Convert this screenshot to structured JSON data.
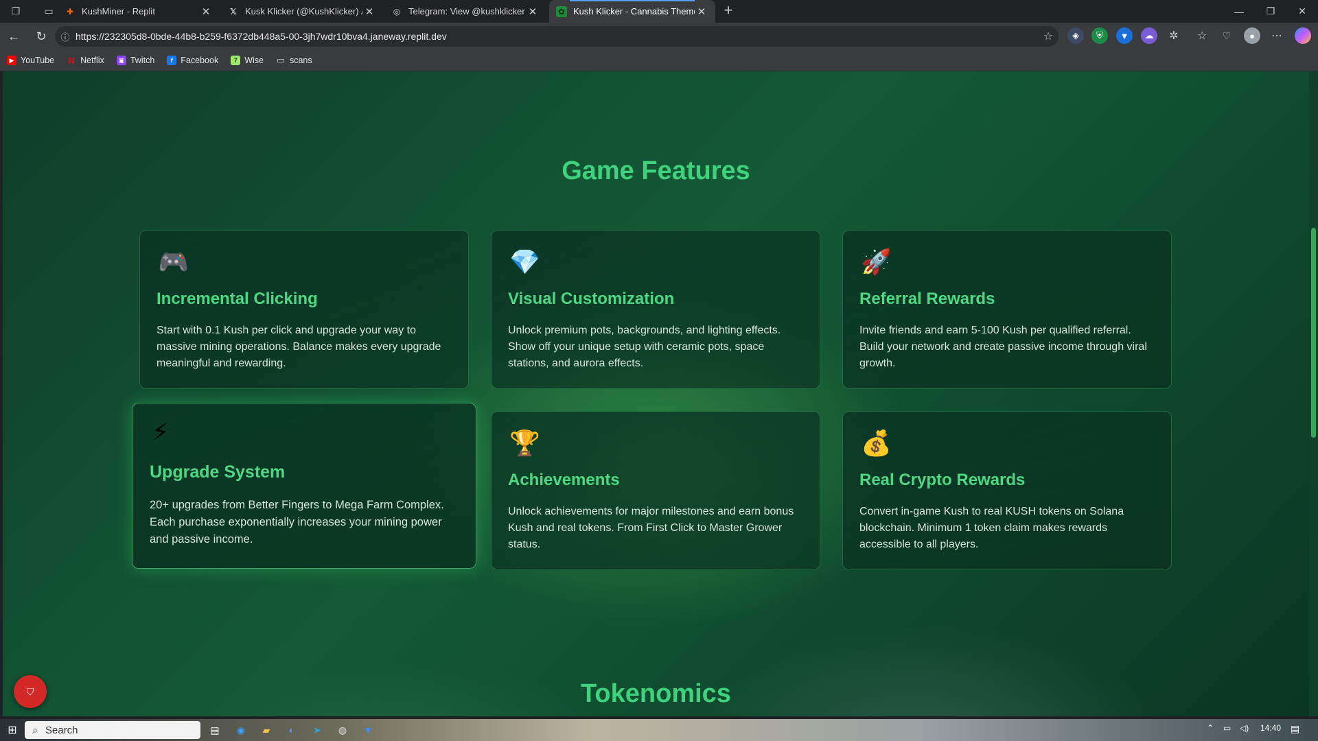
{
  "browser": {
    "tabs": [
      {
        "title": "KushMiner - Replit",
        "favicon": "replit-icon",
        "favcolor": "#f26207"
      },
      {
        "title": "Kusk Klicker (@KushKlicker) / X",
        "favicon": "x-icon",
        "favcolor": "#000000"
      },
      {
        "title": "Telegram: View @kushklicker",
        "favicon": "globe-icon",
        "favcolor": "#444444"
      },
      {
        "title": "Kush Klicker - Cannabis Themed C",
        "favicon": "leaf-icon",
        "favcolor": "#1f8a3b"
      }
    ],
    "url": "https://232305d8-0bde-44b8-b259-f6372db448a5-00-3jh7wdr10bva4.janeway.replit.dev",
    "bookmarks": [
      {
        "label": "YouTube",
        "icon": "youtube-icon",
        "color": "#ff0000"
      },
      {
        "label": "Netflix",
        "icon": "netflix-icon",
        "color": "#e50914"
      },
      {
        "label": "Twitch",
        "icon": "twitch-icon",
        "color": "#9146ff"
      },
      {
        "label": "Facebook",
        "icon": "facebook-icon",
        "color": "#1877f2"
      },
      {
        "label": "Wise",
        "icon": "wise-icon",
        "color": "#9fe870"
      },
      {
        "label": "scans",
        "icon": "folder-icon",
        "color": "#cccccc"
      }
    ]
  },
  "page": {
    "features_title": "Game Features",
    "features": [
      {
        "icon": "🎮",
        "icon_name": "gamepad-icon",
        "title": "Incremental Clicking",
        "desc": "Start with 0.1 Kush per click and upgrade your way to massive mining operations. Balance makes every upgrade meaningful and rewarding."
      },
      {
        "icon": "💎",
        "icon_name": "gem-icon",
        "title": "Visual Customization",
        "desc": "Unlock premium pots, backgrounds, and lighting effects. Show off your unique setup with ceramic pots, space stations, and aurora effects."
      },
      {
        "icon": "🚀",
        "icon_name": "rocket-icon",
        "title": "Referral Rewards",
        "desc": "Invite friends and earn 5-100 Kush per qualified referral. Build your network and create passive income through viral growth."
      },
      {
        "icon": "⚡",
        "icon_name": "lightning-icon",
        "title": "Upgrade System",
        "desc": "20+ upgrades from Better Fingers to Mega Farm Complex. Each purchase exponentially increases your mining power and passive income."
      },
      {
        "icon": "🏆",
        "icon_name": "trophy-icon",
        "title": "Achievements",
        "desc": "Unlock achievements for major milestones and earn bonus Kush and real tokens. From First Click to Master Grower status."
      },
      {
        "icon": "💰",
        "icon_name": "money-bag-icon",
        "title": "Real Crypto Rewards",
        "desc": "Convert in-game Kush to real KUSH tokens on Solana blockchain. Minimum 1 token claim makes rewards accessible to all players."
      }
    ],
    "tokenomics_title": "Tokenomics",
    "accent_color": "#3ed27c"
  },
  "taskbar": {
    "search_placeholder": "Search",
    "time": "14:40"
  }
}
